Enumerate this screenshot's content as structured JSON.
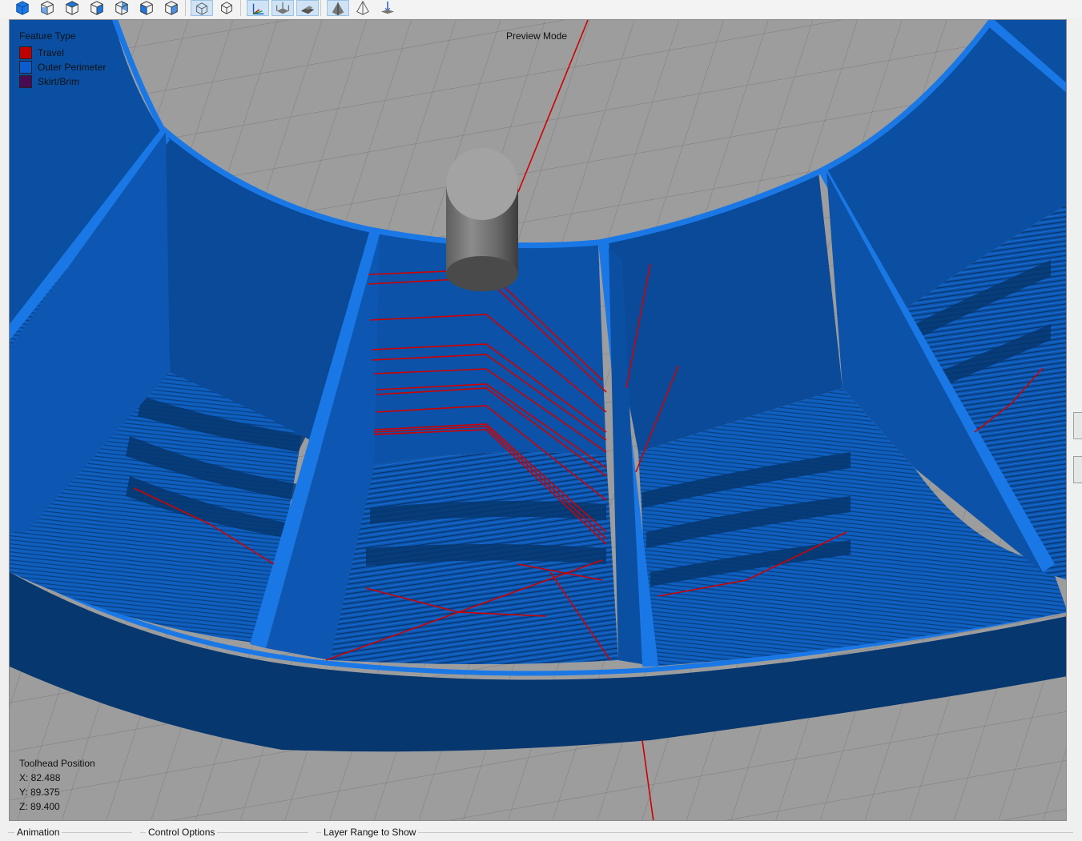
{
  "toolbar": {
    "buttons": [
      {
        "name": "view-iso-button",
        "icon": "cube-solid-icon"
      },
      {
        "name": "view-front-button",
        "icon": "cube-wire-icon"
      },
      {
        "name": "view-top-button",
        "icon": "cube-top-icon"
      },
      {
        "name": "view-side-button",
        "icon": "cube-side-icon"
      },
      {
        "name": "view-back-button",
        "icon": "cube-back-icon"
      },
      {
        "name": "view-left-button",
        "icon": "cube-left-icon"
      },
      {
        "name": "view-right-button",
        "icon": "cube-right-icon"
      },
      {
        "name": "perspective-button",
        "icon": "perspective-cube-icon",
        "active": true
      },
      {
        "name": "orthographic-button",
        "icon": "ortho-cube-icon"
      },
      {
        "name": "show-axes-button",
        "icon": "axes-icon",
        "active": true
      },
      {
        "name": "show-bed-button",
        "icon": "build-volume-icon",
        "active": true
      },
      {
        "name": "show-platform-button",
        "icon": "platform-icon",
        "active": true
      },
      {
        "name": "solid-shading-button",
        "icon": "solid-pyramid-icon",
        "active": true
      },
      {
        "name": "wireframe-button",
        "icon": "wire-pyramid-icon"
      },
      {
        "name": "align-bed-button",
        "icon": "align-bed-icon"
      }
    ]
  },
  "viewport": {
    "mode_label": "Preview Mode",
    "legend": {
      "title": "Feature Type",
      "items": [
        {
          "label": "Travel",
          "color": "#c00000"
        },
        {
          "label": "Outer Perimeter",
          "color": "#0a5ccf"
        },
        {
          "label": "Skirt/Brim",
          "color": "#4a0a52"
        }
      ]
    },
    "toolhead": {
      "title": "Toolhead Position",
      "x": "X: 82.488",
      "y": "Y: 89.375",
      "z": "Z: 89.400"
    },
    "colors": {
      "background": "#9d9d9d",
      "bed_grid": "#7e7e7e",
      "perimeter_bright": "#1a78e6",
      "perimeter_mid": "#0d57b3",
      "perimeter_dark": "#06376f",
      "travel": "#d00000",
      "nozzle": "#9a9a9a"
    }
  },
  "bottom_panels": {
    "animation": "Animation",
    "control_options": "Control Options",
    "layer_range": "Layer Range to Show"
  }
}
